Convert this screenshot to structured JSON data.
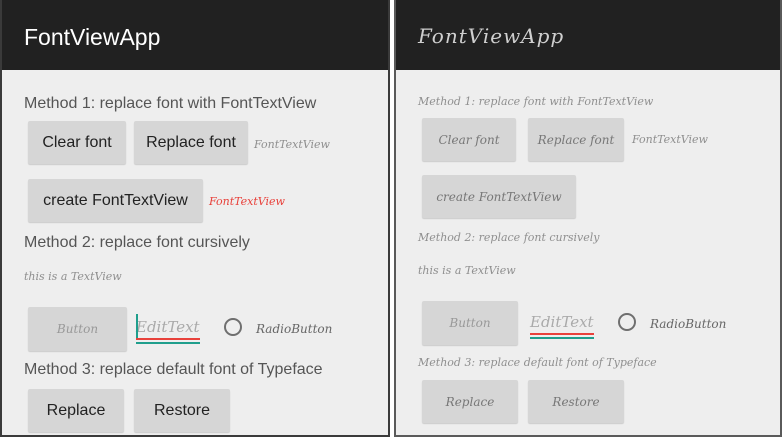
{
  "colors": {
    "appbar": "#212121",
    "accent_red": "#e8413b",
    "accent_teal": "#1f9e8c",
    "screen_bg": "#eeeeee"
  },
  "left": {
    "app_title": "FontViewApp",
    "method1": "Method 1: replace font with FontTextView",
    "clear_font": "Clear font",
    "replace_font": "Replace font",
    "fonttextview_label": "FontTextView",
    "create_button": "create FontTextView",
    "fonttextview_red": "FontTextView",
    "method2": "Method 2: replace font cursively",
    "textview": "this is a TextView",
    "button": "Button",
    "edittext": "EditText",
    "radiobutton": "RadioButton",
    "method3": "Method 3: replace default font of Typeface",
    "replace": "Replace",
    "restore": "Restore"
  },
  "right": {
    "app_title": "FontViewApp",
    "method1": "Method 1: replace font with FontTextView",
    "clear_font": "Clear font",
    "replace_font": "Replace font",
    "fonttextview_label": "FontTextView",
    "create_button": "create FontTextView",
    "method2": "Method 2: replace font cursively",
    "textview": "this is a TextView",
    "button": "Button",
    "edittext": "EditText",
    "radiobutton": "RadioButton",
    "method3": "Method 3: replace default font of Typeface",
    "replace": "Replace",
    "restore": "Restore"
  }
}
